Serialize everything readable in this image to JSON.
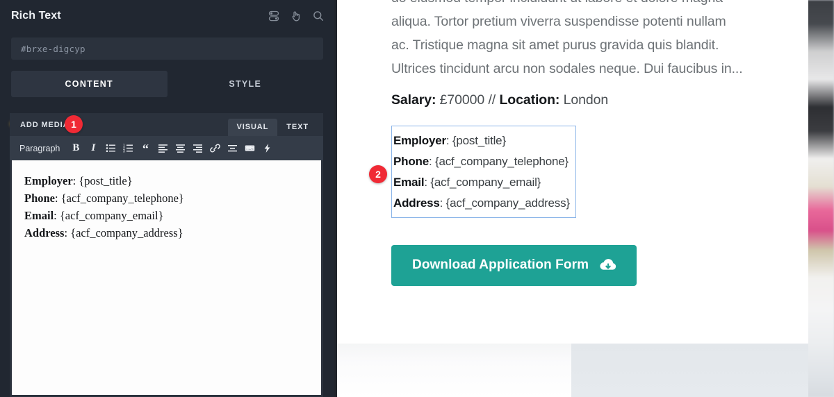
{
  "panel": {
    "title": "Rich Text",
    "header_icons": [
      {
        "name": "toggles-icon",
        "label": "toggles"
      },
      {
        "name": "pointer-icon",
        "label": "pointer"
      },
      {
        "name": "search-icon",
        "label": "search"
      }
    ],
    "element_id": "#brxe-digcyp",
    "tabs": [
      {
        "label": "CONTENT",
        "active": true
      },
      {
        "label": "STYLE",
        "active": false
      }
    ],
    "editor": {
      "add_media_label": "ADD MEDIA",
      "mode_tabs": [
        {
          "label": "VISUAL",
          "active": true
        },
        {
          "label": "TEXT",
          "active": false
        }
      ],
      "format_select": "Paragraph",
      "toolbar_icons": [
        "bold-icon",
        "italic-icon",
        "bulleted-list-icon",
        "numbered-list-icon",
        "blockquote-icon",
        "align-left-icon",
        "align-center-icon",
        "align-right-icon",
        "link-icon",
        "read-more-icon",
        "keyboard-shortcuts-icon",
        "lightning-icon"
      ],
      "content_lines": [
        {
          "label": "Employer",
          "value": "{post_title}"
        },
        {
          "label": "Phone",
          "value": "{acf_company_telephone}"
        },
        {
          "label": "Email",
          "value": "{acf_company_email}"
        },
        {
          "label": "Address",
          "value": "{acf_company_address}"
        }
      ]
    }
  },
  "preview": {
    "paragraph_lines": [
      "do eiusmod tempor incididunt ut labore et dolore magna",
      "aliqua. Tortor pretium viverra suspendisse potenti nullam",
      "ac. Tristique magna sit amet purus gravida quis blandit.",
      "Ultrices tincidunt arcu non sodales neque. Dui faucibus in..."
    ],
    "meta": {
      "salary_label": "Salary:",
      "salary_value": "£70000",
      "separator": "//",
      "location_label": "Location:",
      "location_value": "London"
    },
    "highlighted_box": [
      {
        "label": "Employer",
        "value": "{post_title}"
      },
      {
        "label": "Phone",
        "value": "{acf_company_telephone}"
      },
      {
        "label": "Email",
        "value": "{acf_company_email}"
      },
      {
        "label": "Address",
        "value": "{acf_company_address}"
      }
    ],
    "download_button": {
      "label": "Download Application Form",
      "icon": "cloud-download-icon",
      "color": "#1ea295"
    }
  },
  "callouts": [
    {
      "number": "1",
      "target": "add-media-button"
    },
    {
      "number": "2",
      "target": "preview-contact-box"
    }
  ],
  "colors": {
    "panel_bg": "#212731",
    "accent_badge": "#f02a35",
    "button_teal": "#1ea295",
    "selection_border": "#8ab4e8"
  }
}
